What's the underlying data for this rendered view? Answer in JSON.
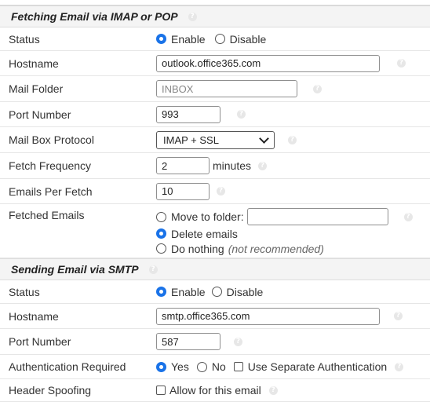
{
  "imap": {
    "section_title": "Fetching Email via IMAP or POP",
    "status": {
      "label": "Status",
      "enable": "Enable",
      "disable": "Disable"
    },
    "hostname": {
      "label": "Hostname",
      "value": "outlook.office365.com"
    },
    "mail_folder": {
      "label": "Mail Folder",
      "placeholder": "INBOX"
    },
    "port": {
      "label": "Port Number",
      "value": "993"
    },
    "protocol": {
      "label": "Mail Box Protocol",
      "selected": "IMAP + SSL"
    },
    "frequency": {
      "label": "Fetch Frequency",
      "value": "2",
      "unit": "minutes"
    },
    "per_fetch": {
      "label": "Emails Per Fetch",
      "value": "10"
    },
    "fetched": {
      "label": "Fetched Emails",
      "move": "Move to folder:",
      "delete": "Delete emails",
      "nothing": "Do nothing",
      "nothing_note": "(not recommended)"
    }
  },
  "smtp": {
    "section_title": "Sending Email via SMTP",
    "status": {
      "label": "Status",
      "enable": "Enable",
      "disable": "Disable"
    },
    "hostname": {
      "label": "Hostname",
      "value": "smtp.office365.com"
    },
    "port": {
      "label": "Port Number",
      "value": "587"
    },
    "auth": {
      "label": "Authentication Required",
      "yes": "Yes",
      "no": "No",
      "separate": "Use Separate Authentication"
    },
    "spoof": {
      "label": "Header Spoofing",
      "allow": "Allow for this email"
    }
  },
  "help_glyph": "?",
  "colors": {
    "radio_selected": "#1a73e8",
    "section_bg": "#f4f4f4"
  }
}
